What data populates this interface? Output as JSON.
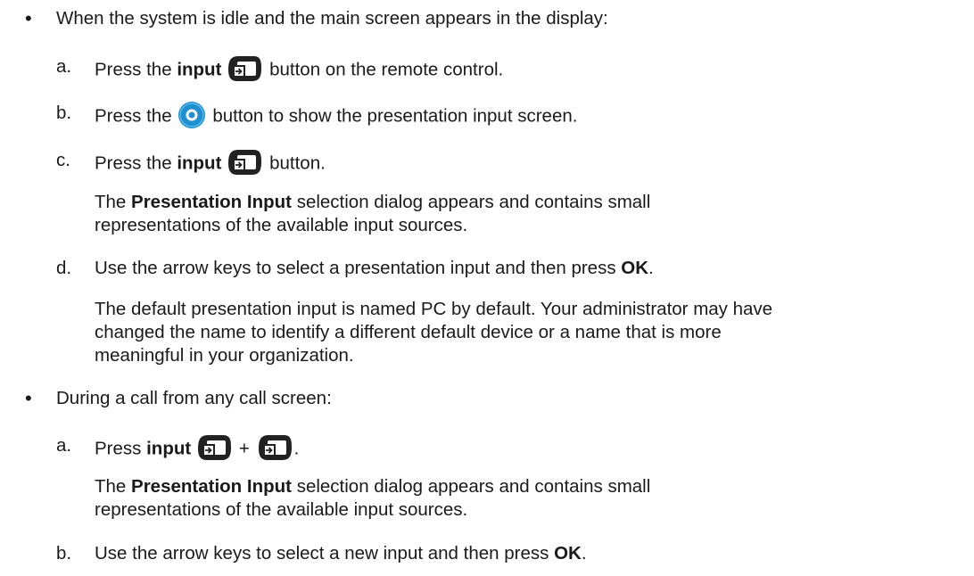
{
  "bullet_char": "•",
  "section1": {
    "intro": "When the system is idle and the main screen appears in the display:",
    "step_a": {
      "letter": "a.",
      "pre": "Press the",
      "bold": "input",
      "icon": "input-icon",
      "post": "button on the remote control."
    },
    "step_b": {
      "letter": "b.",
      "pre": "Press the",
      "icon": "home-circle-icon",
      "post": "button to show the presentation input screen."
    },
    "step_c": {
      "letter": "c.",
      "pre": "Press the",
      "bold": "input",
      "icon": "input-icon",
      "post": "button."
    },
    "note_c": {
      "pre": "The",
      "bold": "Presentation Input",
      "post_line1": "selection dialog appears and contains small",
      "line2": "representations of the available input sources."
    },
    "step_d": {
      "letter": "d.",
      "pre": "Use the arrow keys to select a presentation input and then press",
      "bold": "OK",
      "post": "."
    },
    "note_d": {
      "line1": "The default presentation input is named PC by default. Your administrator may have",
      "line2": "changed the name to identify a different default device or a name that is more",
      "line3": "meaningful in your organization."
    }
  },
  "section2": {
    "intro": "During a call from any call screen:",
    "step_a": {
      "letter": "a.",
      "pre": "Press",
      "bold": "input",
      "plus": "+",
      "icon": "input-icon",
      "post": "."
    },
    "note_a": {
      "pre": "The",
      "bold": "Presentation Input",
      "post_line1": "selection dialog appears and contains small",
      "line2": "representations of the available input sources."
    },
    "step_b": {
      "letter": "b.",
      "pre": "Use the arrow keys to select a new input and then press",
      "bold": "OK",
      "post": "."
    }
  },
  "colors": {
    "text": "#1a1a1a",
    "icon_dark": "#222222",
    "home_button_blue": "#1e8fd0"
  }
}
